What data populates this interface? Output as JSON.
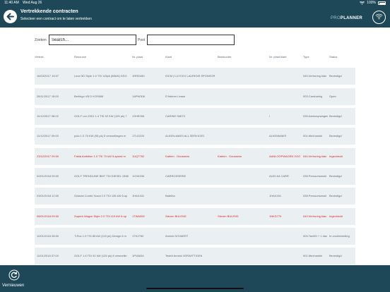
{
  "status": {
    "time": "11:40 AM",
    "date": "Wed Aug 26",
    "battery": "100%"
  },
  "header": {
    "title": "Vertrekkende contracten",
    "subtitle": "Selecteer een contract om te laten vertrekken",
    "brand_pro": "PRO",
    "brand_planner": "PLANNER"
  },
  "filters": {
    "search_label": "Zoeken",
    "search_placeholder": "Search...",
    "search_value": "",
    "pool_label": "Pool",
    "pool_value": ""
  },
  "columns": [
    "Vertrek",
    "Resource",
    "Nr. plaat",
    "Klant",
    "Bestuurder",
    "Nr. plaat klant",
    "Type",
    "Status"
  ],
  "rows": [
    {
      "vertrek": "16/03/2017 15:07",
      "resource": "Leon 5D Style 1.0 TSI 115pk (85kW) DSG",
      "plaat": "1RRD450",
      "klant": "ISCM | LUYCKX LAURENS SPONSOR",
      "bestuurder": "",
      "plaat_klant": "",
      "type": "040.Verhuring klan",
      "status": "Bevestigd",
      "red": false
    },
    {
      "vertrek": "28/11/2017 15:00",
      "resource": "Berlingo VB D KOS658",
      "plaat": "1APW306",
      "klant": "D'Ieteren Lease",
      "bestuurder": "",
      "plaat_klant": "",
      "type": "003.Carsharing",
      "status": "Open",
      "red": false
    },
    {
      "vertrek": "11/12/2017 08:02",
      "resource": "GOLF Leo DSG 1.4 TSI 92 KW (125 pk) 7",
      "plaat": "1SHE096",
      "klant": "CARINE SMITZ",
      "bestuurder": "",
      "plaat_klant": "/",
      "type": "035.Aankoopwagen",
      "status": "Bevestigd",
      "red": false
    },
    {
      "vertrek": "11/12/2017 09:00",
      "resource": "polo 1.0 75 KW (95 pk) 5 versnellingen m",
      "plaat": "1TLG228",
      "klant": "ALKEN-MAES ALL SERVICES",
      "bestuurder": "",
      "plaat_klant": "ALKENMAES",
      "type": "001.Mechaniek",
      "status": "Bevestigd",
      "red": false
    },
    {
      "vertrek": "23/12/2017 09:00",
      "resource": "Fabia Ambition 1.0 TSI 70 kW 5-speed m",
      "plaat": "1UQT762",
      "klant": "Katrien . Goossens",
      "bestuurder": "Katrien . Goossens",
      "plaat_klant": "AANLOOPWAGEN VOO",
      "type": "040.Verhuring klan",
      "status": "Ingecheckt",
      "red": true
    },
    {
      "vertrek": "02/01/2018 09:00",
      "resource": "GOLF TRENDLINE BMT TDI DIESEL 1598",
      "plaat": "1GXK036",
      "klant": "CARROSSERIE",
      "bestuurder": "",
      "plaat_klant": "AUDI A4 CARR",
      "type": "035.Persoonwesld",
      "status": "Bevestigd",
      "red": false
    },
    {
      "vertrek": "03/01/2018 12:00",
      "resource": "Octavia Combi Scout 2.0 TDI 135 kW 6-sp",
      "plaat": "1HAX431",
      "klant": "Batelha",
      "bestuurder": "",
      "plaat_klant": "1HAX431",
      "type": "035.Persoonwesld",
      "status": "Bevestigd",
      "red": false
    },
    {
      "vertrek": "08/01/2018 09:00",
      "resource": "Superb Wagon Style 2.0 TDI 110 kW 6-sp",
      "plaat": "1TWA553",
      "klant": "Steven BULENS",
      "bestuurder": "Steven BULENS",
      "plaat_klant": "1NKD776",
      "type": "040.Verhuring klan",
      "status": "Ingecheckt",
      "red": true
    },
    {
      "vertrek": "10/01/2018 08:00",
      "resource": "T-Roc 1.0 TSI 85 kW (115 pk) Design 6 m",
      "plaat": "1TKZ768",
      "klant": "Annick GOVAERT",
      "bestuurder": "",
      "plaat_klant": "",
      "type": "004.Taxi/Kt + 1 dan",
      "status": "In voorbereiding",
      "red": false
    },
    {
      "vertrek": "11/01/2018 07:00",
      "resource": "GOLF 1.6 TDI 92 kW (125 pk) 8 versnellin",
      "plaat": "1PVA634",
      "klant": "Testrit Annick VERWITTIGEN",
      "bestuurder": "",
      "plaat_klant": "",
      "type": "001.Mechaniek",
      "status": "Bevestigd",
      "red": false
    }
  ],
  "footer": {
    "refresh_label": "Vernieuwen"
  },
  "colors": {
    "header_bg": "#1e4858",
    "row_bg": "#eaf0f2",
    "alert": "#e02020"
  },
  "icons": {
    "back": "arrow-left-icon",
    "wifi": "wifi-icon",
    "refresh": "refresh-icon"
  }
}
